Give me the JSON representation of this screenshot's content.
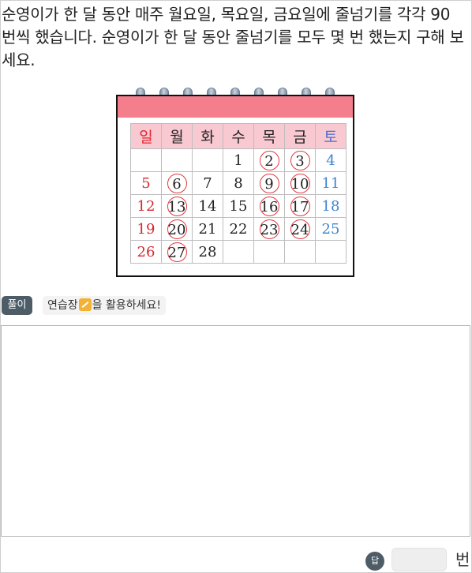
{
  "question": "순영이가 한 달 동안 매주 월요일, 목요일, 금요일에 줄넘기를 각각 90 번씩 했습니다. 순영이가 한 달 동안 줄넘기를 모두 몇 번 했는지 구해 보세요.",
  "calendar": {
    "headers": [
      "일",
      "월",
      "화",
      "수",
      "목",
      "금",
      "토"
    ],
    "weeks": [
      [
        "",
        "",
        "",
        "1",
        "2",
        "3",
        "4"
      ],
      [
        "5",
        "6",
        "7",
        "8",
        "9",
        "10",
        "11"
      ],
      [
        "12",
        "13",
        "14",
        "15",
        "16",
        "17",
        "18"
      ],
      [
        "19",
        "20",
        "21",
        "22",
        "23",
        "24",
        "25"
      ],
      [
        "26",
        "27",
        "28",
        "",
        "",
        "",
        ""
      ]
    ],
    "circled": [
      "2",
      "3",
      "6",
      "9",
      "10",
      "13",
      "16",
      "17",
      "20",
      "23",
      "24",
      "27"
    ],
    "colors": {
      "sunday": "#d7262e",
      "saturday": "#3f83cf",
      "header_bg": "#f9c9d2",
      "top_bar": "#f47e8b",
      "circle": "#e0393f"
    }
  },
  "solution": {
    "badge": "풀이",
    "hint_before": "연습장",
    "hint_icon": "notepad-icon",
    "hint_after": "을 활용하세요!"
  },
  "answer": {
    "badge": "답",
    "value": "",
    "unit": "번"
  }
}
